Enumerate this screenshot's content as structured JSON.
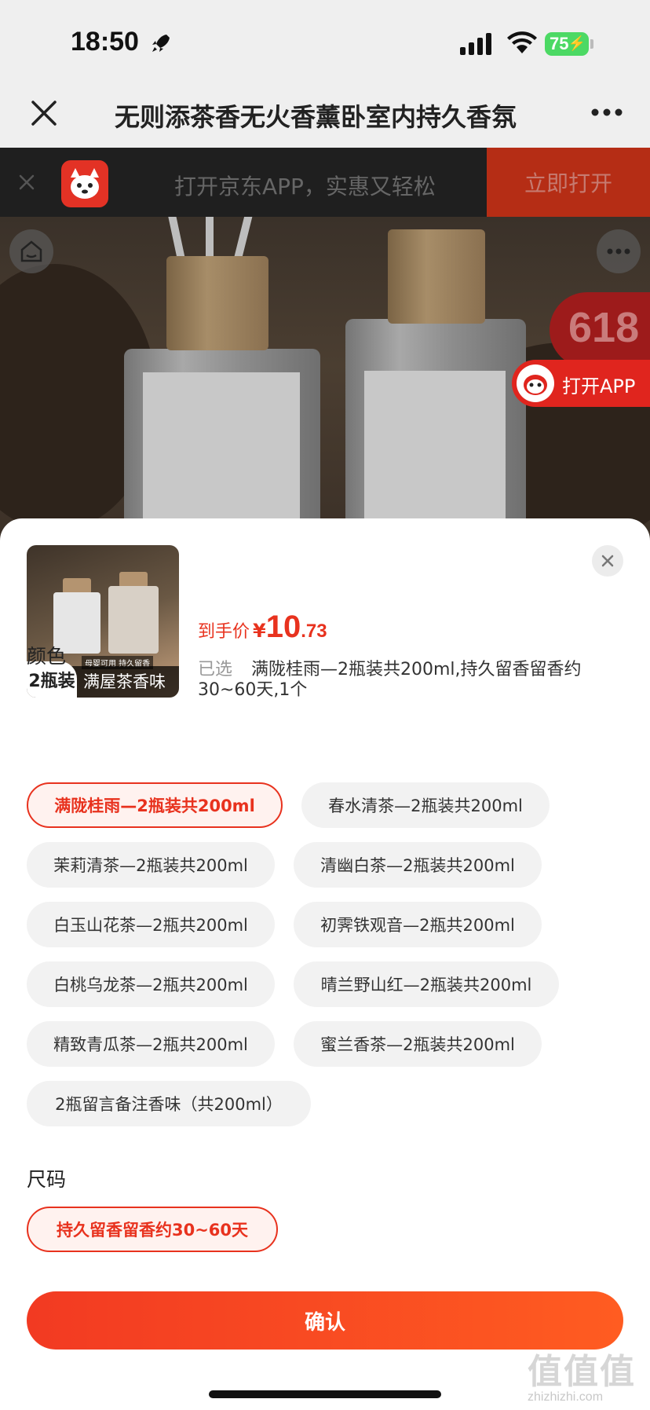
{
  "status_bar": {
    "time": "18:50",
    "battery": "75"
  },
  "nav": {
    "title": "无则添茶香无火香薰卧室内持久香氛"
  },
  "app_banner": {
    "text": "打开京东APP，实惠又轻松",
    "open_label": "立即打开"
  },
  "hero": {
    "badge": "618",
    "open_app_label": "打开APP"
  },
  "product": {
    "thumb_pack_label": "2瓶装",
    "thumb_note": "母婴可用 持久留香",
    "thumb_caption": "满屋茶香味",
    "price_label": "到手价",
    "currency": "¥",
    "price_int": "10",
    "price_dec": ".73",
    "selected_label": "已选",
    "selected_value": "满陇桂雨—2瓶装共200ml,持久留香留香约30~60天,1个"
  },
  "color_section": {
    "title": "颜色",
    "options": [
      {
        "label": "满陇桂雨—2瓶装共200ml",
        "selected": true
      },
      {
        "label": "春水清茶—2瓶装共200ml",
        "selected": false
      },
      {
        "label": "茉莉清茶—2瓶装共200ml",
        "selected": false
      },
      {
        "label": "清幽白茶—2瓶装共200ml",
        "selected": false
      },
      {
        "label": "白玉山花茶—2瓶共200ml",
        "selected": false
      },
      {
        "label": "初霁铁观音—2瓶共200ml",
        "selected": false
      },
      {
        "label": "白桃乌龙茶—2瓶共200ml",
        "selected": false
      },
      {
        "label": "晴兰野山红—2瓶装共200ml",
        "selected": false
      },
      {
        "label": "精致青瓜茶—2瓶共200ml",
        "selected": false
      },
      {
        "label": "蜜兰香茶—2瓶装共200ml",
        "selected": false
      },
      {
        "label": "2瓶留言备注香味（共200ml）",
        "selected": false
      }
    ]
  },
  "size_section": {
    "title": "尺码",
    "options": [
      {
        "label": "持久留香留香约30~60天",
        "selected": true
      }
    ]
  },
  "confirm_label": "确认",
  "watermark": {
    "mark": "值值值",
    "text": "zhizhizhi.com"
  },
  "colors": {
    "accent": "#e8321e",
    "chip_bg": "#f2f2f2",
    "selected_bg": "#fff2ef"
  }
}
